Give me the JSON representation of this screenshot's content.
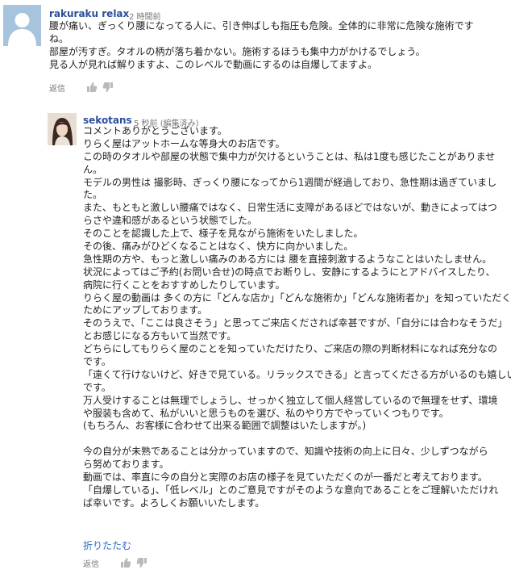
{
  "comments": [
    {
      "author": "rakuraku relax",
      "time": "2 時間前",
      "lines": [
        "腰が痛い、ぎっくり腰になってる人に、引き伸ばしも指圧も危険。全体的に非常に危険な施術です",
        "ね。",
        "部屋が汚すぎ。タオルの柄が落ち着かない。施術するほうも集中力がかけるでしょう。",
        "見る人が見れば解りますよ、このレベルで動画にするのは自爆してますよ。"
      ],
      "reply_label": "返信",
      "avatar_icon": "default-user-silhouette"
    },
    {
      "author": "sekotans",
      "time": "5 秒前 (編集済み)",
      "lines": [
        "コメントありがとうございます。",
        "りらく屋はアットホームな等身大のお店です。",
        "この時のタオルや部屋の状態で集中力が欠けるということは、私は1度も感じたことがありませ",
        "ん。",
        "モデルの男性は 撮影時、ぎっくり腰になってから1週間が経過しており、急性期は過ぎていまし",
        "た。",
        "また、もともと激しい腰痛ではなく、日常生活に支障があるほどではないが、動きによってはつ",
        "らさや違和感があるという状態でした。",
        "そのことを認識した上で、様子を見ながら施術をいたしました。",
        "その後、痛みがひどくなることはなく、快方に向かいました。",
        "急性期の方や、もっと激しい痛みのある方には 腰を直接刺激するようなことはいたしません。",
        "状況によってはご予約(お問い合せ)の時点でお断りし、安静にするようにとアドバイスしたり、",
        "病院に行くことをおすすめしたりしています。",
        "りらく屋の動画は 多くの方に「どんな店か」「どんな施術か」「どんな施術者か」を知っていただく",
        "ためにアップしております。",
        "そのうえで、「ここは良さそう」と思ってご来店くだされば幸甚ですが、「自分には合わなそうだ」",
        "とお感じになる方もいて当然です。",
        "どちらにしてもりらく屋のことを知っていただけたり、ご来店の際の判断材料になれば充分なの",
        "です。",
        "「遠くて行けないけど、好きで見ている。リラックスできる」と言ってくださる方がいるのも嬉しい",
        "です。",
        "万人受けすることは無理でしょうし、せっかく独立して個人経営しているので無理をせず、環境",
        "や服装も含めて、私がいいと思うものを選び、私のやり方でやっていくつもりです。",
        "(もちろん、お客様に合わせて出来る範囲で調整はいたしますが。)",
        "",
        "今の自分が未熟であることは分かっていますので、知識や技術の向上に日々、少しずつながら",
        "ら努めております。",
        "動画では、率直に今の自分と実際のお店の様子を見ていただくのが一番だと考えております。",
        "「自爆している」、「低レベル」とのご意見ですがそのような意向であることをご理解いただけれ",
        "ば幸いです。よろしくお願いいたします。"
      ],
      "collapse_label": "折りたたむ",
      "reply_label": "返信",
      "avatar_icon": "profile-photo"
    }
  ],
  "colors": {
    "author": "#2b4f99",
    "meta": "#777777",
    "link": "#2b6bc7",
    "text": "#222222",
    "avatar_default_bg": "#a7c3de"
  }
}
